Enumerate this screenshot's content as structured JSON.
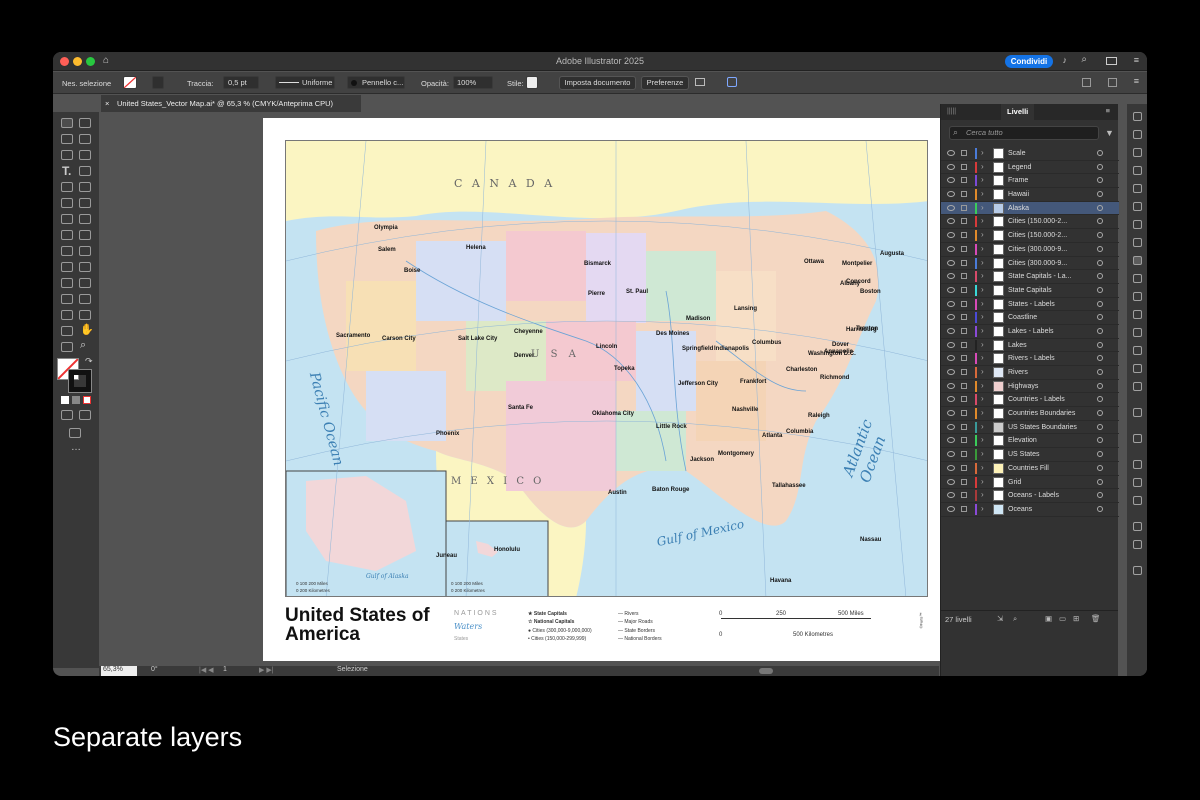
{
  "window": {
    "title": "Adobe Illustrator 2025",
    "share_label": "Condividi"
  },
  "control_bar": {
    "selection": "Nes. selezione",
    "stroke_label": "Traccia:",
    "stroke_value": "0,5 pt",
    "profile": "Uniforme",
    "brush": "Pennello c...",
    "opacity_label": "Opacità:",
    "opacity_value": "100%",
    "style_label": "Stile:",
    "doc_setup": "Imposta documento",
    "preferences": "Preferenze"
  },
  "doc_tab": {
    "close": "×",
    "title": "United States_Vector Map.ai* @ 65,3 % (CMYK/Anteprima CPU)"
  },
  "map": {
    "canada": "C A N A D A",
    "mexico": "M E X I C O",
    "usa": "U S A",
    "pacific": "Pacific Ocean",
    "atlantic": "Atlantic Ocean",
    "gulf": "Gulf of Mexico",
    "gulf_alaska": "Gulf of Alaska",
    "capitals": [
      {
        "name": "Olympia"
      },
      {
        "name": "Salem"
      },
      {
        "name": "Boise"
      },
      {
        "name": "Helena"
      },
      {
        "name": "Bismarck"
      },
      {
        "name": "Pierre"
      },
      {
        "name": "Cheyenne"
      },
      {
        "name": "Salt Lake City"
      },
      {
        "name": "Carson City"
      },
      {
        "name": "Sacramento"
      },
      {
        "name": "Denver"
      },
      {
        "name": "Lincoln"
      },
      {
        "name": "Topeka"
      },
      {
        "name": "Des Moines"
      },
      {
        "name": "St. Paul"
      },
      {
        "name": "Madison"
      },
      {
        "name": "Lansing"
      },
      {
        "name": "Springfield"
      },
      {
        "name": "Indianapolis"
      },
      {
        "name": "Columbus"
      },
      {
        "name": "Jefferson City"
      },
      {
        "name": "Oklahoma City"
      },
      {
        "name": "Santa Fe"
      },
      {
        "name": "Phoenix"
      },
      {
        "name": "Austin"
      },
      {
        "name": "Little Rock"
      },
      {
        "name": "Jackson"
      },
      {
        "name": "Baton Rouge"
      },
      {
        "name": "Montgomery"
      },
      {
        "name": "Atlanta"
      },
      {
        "name": "Tallahassee"
      },
      {
        "name": "Nashville"
      },
      {
        "name": "Frankfort"
      },
      {
        "name": "Charleston"
      },
      {
        "name": "Richmond"
      },
      {
        "name": "Raleigh"
      },
      {
        "name": "Columbia"
      },
      {
        "name": "Harrisburg"
      },
      {
        "name": "Trenton"
      },
      {
        "name": "Dover"
      },
      {
        "name": "Annapolis"
      },
      {
        "name": "Washington D.C."
      },
      {
        "name": "Albany"
      },
      {
        "name": "Montpelier"
      },
      {
        "name": "Augusta"
      },
      {
        "name": "Concord"
      },
      {
        "name": "Boston"
      },
      {
        "name": "Ottawa"
      },
      {
        "name": "Honolulu"
      },
      {
        "name": "Juneau"
      },
      {
        "name": "Havana"
      },
      {
        "name": "Nassau"
      }
    ],
    "title": "United States of America",
    "legend": {
      "nations": "NATIONS",
      "waters": "Waters",
      "states": "States",
      "state_capitals": "State Capitals",
      "national_capitals": "National Capitals",
      "cities_big": "Cities (300,000-9,000,000)",
      "cities_small": "Cities (150,000-299,999)",
      "rivers": "Rivers",
      "roads": "Major Roads",
      "state_borders": "State Borders",
      "national_borders": "National Borders"
    },
    "scale": {
      "zero_a": "0",
      "mid_a": "250",
      "end_a": "500 Miles",
      "zero_b": "0",
      "end_b": "500 Kilometres",
      "ak_a": "0   100   200 Miles",
      "ak_b": "0   200 Kilometres",
      "hi_a": "0    100   200 Miles",
      "hi_b": "0    200 Kilometres"
    },
    "brand": "©Furis™"
  },
  "status": {
    "zoom": "65,3%",
    "rotation": "0°",
    "page": "1",
    "tool": "Selezione"
  },
  "layers_panel": {
    "tab": "Livelli",
    "search_placeholder": "Cerca tutto",
    "count": "27 livelli",
    "layers": [
      {
        "name": "Scale",
        "color": "#4a7bd8",
        "thumb": "#fff"
      },
      {
        "name": "Legend",
        "color": "#d83a3a",
        "thumb": "#fff"
      },
      {
        "name": "Frame",
        "color": "#7b4ad8",
        "thumb": "#fff"
      },
      {
        "name": "Hawaii",
        "color": "#e08a2a",
        "thumb": "#fff"
      },
      {
        "name": "Alaska",
        "color": "#3acc5a",
        "thumb": "#b8cce8",
        "selected": true
      },
      {
        "name": "Cities (150.000-2...",
        "color": "#d83a3a",
        "thumb": "#fff"
      },
      {
        "name": "Cities (150.000-2...",
        "color": "#e08a2a",
        "thumb": "#fff"
      },
      {
        "name": "Cities (300.000-9...",
        "color": "#d84ab8",
        "thumb": "#fff"
      },
      {
        "name": "Cities (300.000-9...",
        "color": "#4a7bd8",
        "thumb": "#fff"
      },
      {
        "name": "State Capitals - La...",
        "color": "#d84a6a",
        "thumb": "#fff"
      },
      {
        "name": "State Capitals",
        "color": "#3ad8d8",
        "thumb": "#fff"
      },
      {
        "name": "States - Labels",
        "color": "#d84ab8",
        "thumb": "#fff"
      },
      {
        "name": "Coastline",
        "color": "#4a4ad8",
        "thumb": "#fff"
      },
      {
        "name": "Lakes - Labels",
        "color": "#8a4ad8",
        "thumb": "#fff"
      },
      {
        "name": "Lakes",
        "color": "#222222",
        "thumb": "#fff"
      },
      {
        "name": "Rivers - Labels",
        "color": "#d84ab8",
        "thumb": "#fff"
      },
      {
        "name": "Rivers",
        "color": "#d86a3a",
        "thumb": "#dfe8f5"
      },
      {
        "name": "Highways",
        "color": "#e08a2a",
        "thumb": "#f0d0d0"
      },
      {
        "name": "Countries - Labels",
        "color": "#d84a6a",
        "thumb": "#fff"
      },
      {
        "name": "Countries Boundaries",
        "color": "#e08a2a",
        "thumb": "#fff"
      },
      {
        "name": "US States Boundaries",
        "color": "#3a9a9a",
        "thumb": "#ccc"
      },
      {
        "name": "Elevation",
        "color": "#3acc5a",
        "thumb": "#fff"
      },
      {
        "name": "US States",
        "color": "#3a9a3a",
        "thumb": "#fff"
      },
      {
        "name": "Countries Fill",
        "color": "#d86a3a",
        "thumb": "#fdf2b8"
      },
      {
        "name": "Grid",
        "color": "#d83a3a",
        "thumb": "#fff"
      },
      {
        "name": "Oceans - Labels",
        "color": "#a83a3a",
        "thumb": "#fff"
      },
      {
        "name": "Oceans",
        "color": "#8a4ad8",
        "thumb": "#cfe6f5"
      }
    ]
  },
  "caption": "Separate layers"
}
